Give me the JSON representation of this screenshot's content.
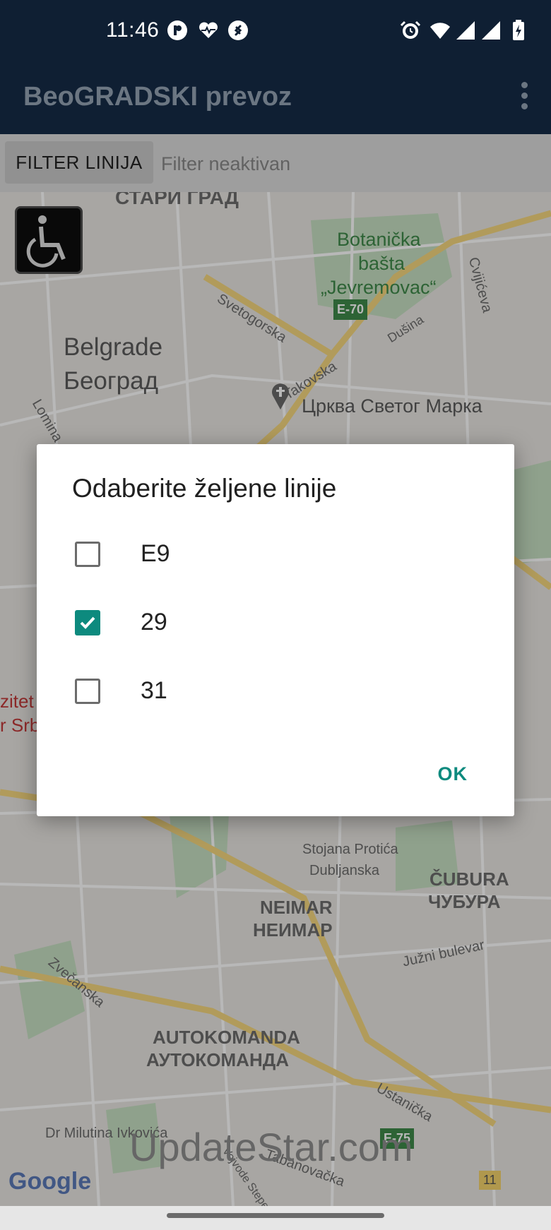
{
  "status_bar": {
    "time": "11:46",
    "icons": [
      "notification-p-icon",
      "heart-rate-icon",
      "shazam-icon",
      "alarm-icon",
      "wifi-icon",
      "signal-icon",
      "signal-icon",
      "battery-charging-icon"
    ]
  },
  "app_bar": {
    "title": "BeoGRADSKI prevoz",
    "menu_icon": "more-vert-icon"
  },
  "filter_bar": {
    "button_label": "FILTER LINIJA",
    "status_text": "Filter neaktivan"
  },
  "map": {
    "accessibility_button_icon": "wheelchair-icon",
    "labels": [
      "СТАРИ ГРАД",
      "Botanička",
      "bašta",
      "„Jevremovac“",
      "Svetogorska",
      "Cvijićeva",
      "Belgrade",
      "Београд",
      "E-70",
      "Dušina",
      "Takovska",
      "Црква Светог Марка",
      "Lomina",
      "zitet",
      "r Srb",
      "Stojana Protića",
      "Dubljanska",
      "ČUBURA",
      "ЧУБУРА",
      "NEIMAR",
      "НЕИМАР",
      "Zvečanska",
      "Južni bulevar",
      "AUTOKOMANDA",
      "АУТОКОМАНДА",
      "Ustanička",
      "Dr Milutina Ivkovića",
      "E-75",
      "Tabanovačka",
      "Vojvode Stepe",
      "11"
    ],
    "google_logo": "Google",
    "watermark": "UpdateStar.com"
  },
  "dialog": {
    "title": "Odaberite željene linije",
    "options": [
      {
        "label": "E9",
        "checked": false
      },
      {
        "label": "29",
        "checked": true
      },
      {
        "label": "31",
        "checked": false
      }
    ],
    "ok_label": "OK"
  },
  "colors": {
    "app_bar": "#0f1f33",
    "accent": "#0d8a7e"
  }
}
